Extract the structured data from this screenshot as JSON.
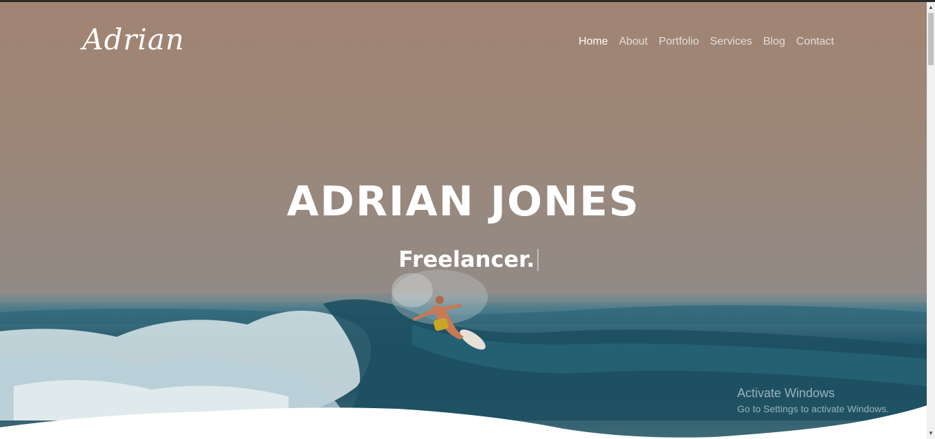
{
  "brand": {
    "logo_text": "Adrian"
  },
  "nav": {
    "items": [
      {
        "label": "Home",
        "active": true
      },
      {
        "label": "About",
        "active": false
      },
      {
        "label": "Portfolio",
        "active": false
      },
      {
        "label": "Services",
        "active": false
      },
      {
        "label": "Blog",
        "active": false
      },
      {
        "label": "Contact",
        "active": false
      }
    ]
  },
  "hero": {
    "title": "ADRIAN JONES",
    "subtitle": "Freelancer.",
    "background_image": "surfer riding an ocean wave at dusk"
  },
  "watermark": {
    "line1": "Activate Windows",
    "line2": "Go to Settings to activate Windows."
  },
  "colors": {
    "text_primary": "#ffffff",
    "nav_inactive": "rgba(255,255,255,0.72)",
    "sky_top": "#a08473",
    "water_deep": "#1f4e5f"
  }
}
